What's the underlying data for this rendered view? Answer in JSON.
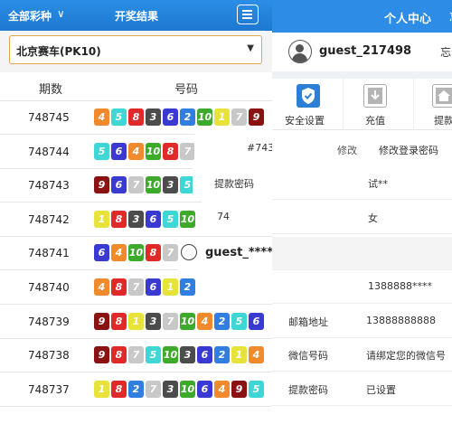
{
  "left_panel": {
    "type_label": "全部彩种",
    "title": "开奖结果",
    "lottery_select": "北京赛车(PK10)",
    "columns": {
      "issue": "期数",
      "numbers": "号码"
    },
    "rows": [
      {
        "issue": "748745",
        "balls": [
          "4",
          "5",
          "8",
          "3",
          "6",
          "2",
          "10",
          "1",
          "7",
          "9"
        ]
      },
      {
        "issue": "748744",
        "balls": [
          "5",
          "6",
          "4",
          "10",
          "8",
          "7"
        ]
      },
      {
        "issue": "748743",
        "balls": [
          "9",
          "6",
          "7",
          "10",
          "3",
          "5"
        ]
      },
      {
        "issue": "748742",
        "balls": [
          "1",
          "8",
          "3",
          "6",
          "5",
          "10"
        ]
      },
      {
        "issue": "748741",
        "balls": [
          "6",
          "4",
          "10",
          "8",
          "7"
        ]
      },
      {
        "issue": "748740",
        "balls": [
          "4",
          "8",
          "7",
          "6",
          "1",
          "2"
        ]
      },
      {
        "issue": "748739",
        "balls": [
          "9",
          "8",
          "1",
          "3",
          "7",
          "10",
          "4",
          "2",
          "5",
          "6"
        ]
      },
      {
        "issue": "748738",
        "balls": [
          "9",
          "8",
          "7",
          "5",
          "10",
          "3",
          "6",
          "2",
          "1",
          "4"
        ]
      },
      {
        "issue": "748737",
        "balls": [
          "1",
          "8",
          "2",
          "7",
          "3",
          "10",
          "6",
          "4",
          "9",
          "5"
        ]
      }
    ],
    "ball_colors": {
      "1": "#e8e33a",
      "2": "#2f7ee0",
      "3": "#4c4c4c",
      "4": "#f08a2c",
      "5": "#3fd6d6",
      "6": "#3a3ad2",
      "7": "#c8c8c8",
      "8": "#e02a2a",
      "9": "#8a1212",
      "10": "#3daa2c"
    }
  },
  "right_panel": {
    "title": "个人中心",
    "title_edge": "忘",
    "username": "guest_217498",
    "username_edge": "忘",
    "icons": [
      {
        "label": "安全设置",
        "icon": "shield-icon"
      },
      {
        "label": "充值",
        "icon": "download-icon"
      },
      {
        "label": "提款",
        "icon": "home-icon"
      }
    ]
  },
  "overlay": {
    "issue_fragment": "#743",
    "modify_pwd": "修改",
    "modify_login_pwd": "修改登录密码",
    "withdraw_pwd": "提款密码",
    "name_value": "试**",
    "number_fragment": "74",
    "gender_value": "女",
    "guest_fragment": "guest_****",
    "phone_value": "1388888****",
    "email_label": "邮箱地址",
    "email_value": "13888888888",
    "wechat_label": "微信号码",
    "wechat_value": "请绑定您的微信号",
    "withdraw_pwd_label": "提款密码",
    "withdraw_pwd_value": "已设置"
  }
}
